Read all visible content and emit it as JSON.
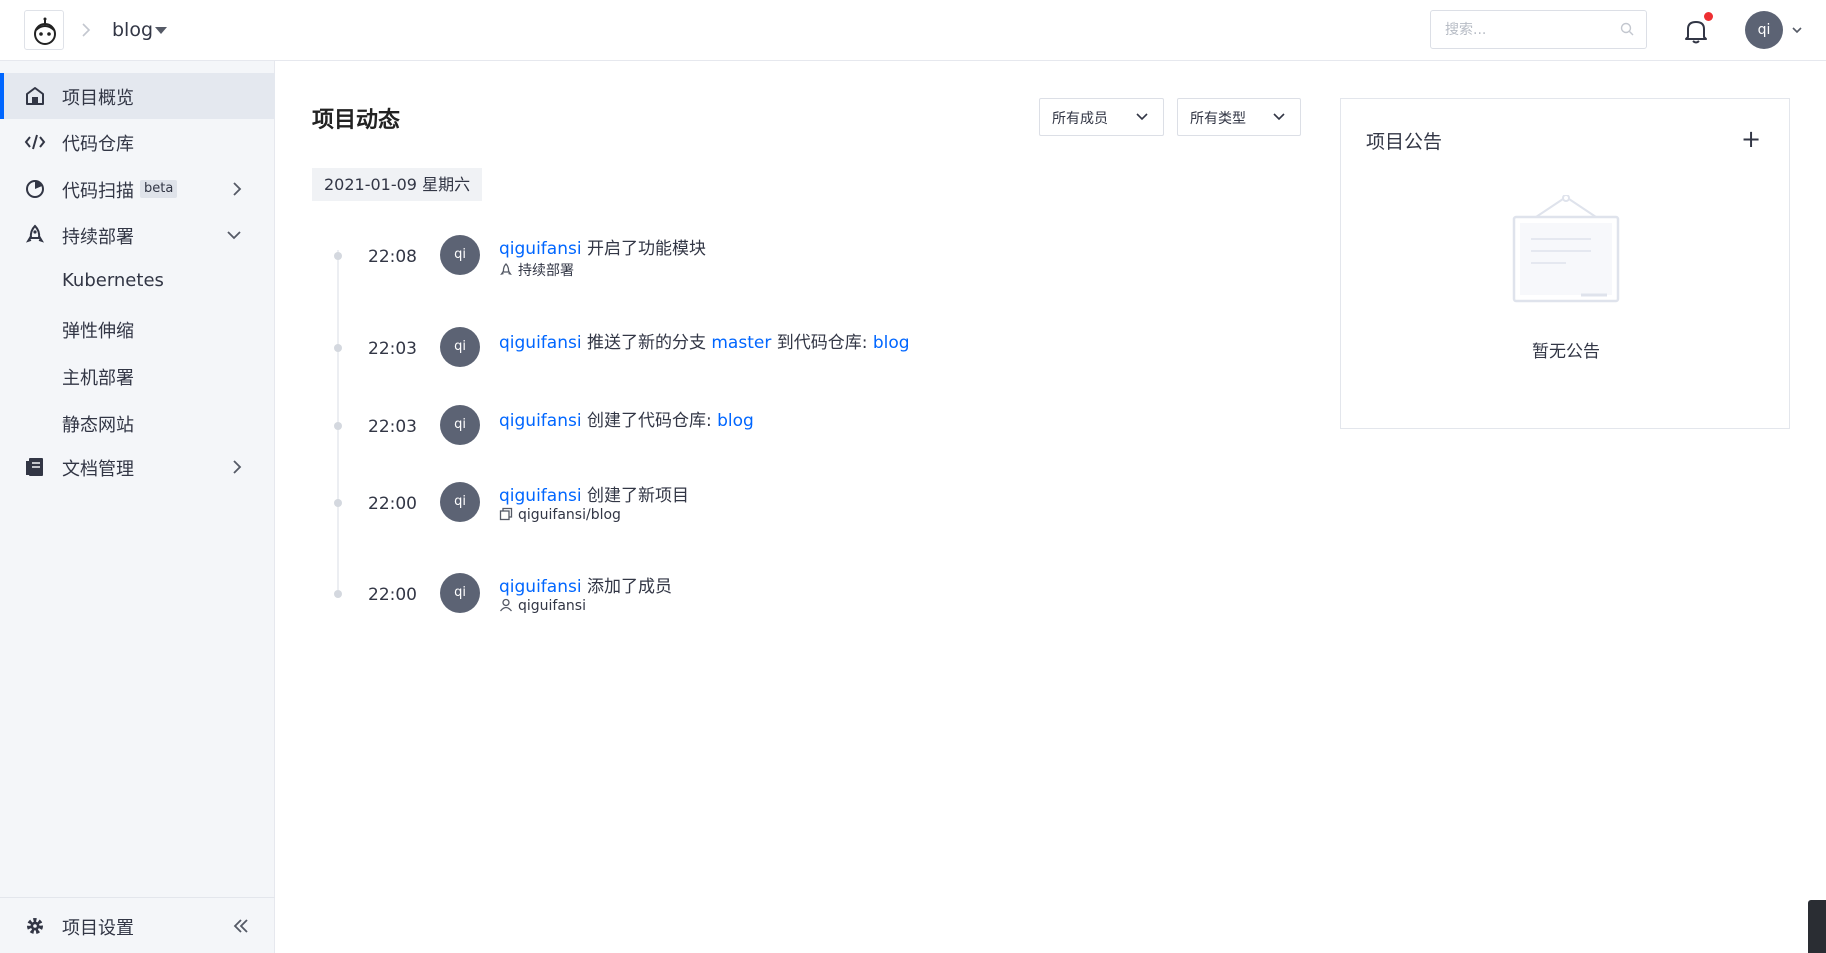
{
  "header": {
    "project_name": "blog",
    "search_placeholder": "搜索...",
    "user_initials": "qi"
  },
  "sidebar": {
    "items": [
      {
        "label": "项目概览",
        "icon": "home-icon",
        "active": true
      },
      {
        "label": "代码仓库",
        "icon": "code-icon"
      },
      {
        "label": "代码扫描",
        "icon": "scan-icon",
        "badge": "beta"
      },
      {
        "label": "持续部署",
        "icon": "rocket-icon"
      },
      {
        "label": "Kubernetes"
      },
      {
        "label": "弹性伸缩"
      },
      {
        "label": "主机部署"
      },
      {
        "label": "静态网站"
      },
      {
        "label": "文档管理",
        "icon": "document-icon"
      }
    ],
    "footer_label": "项目设置"
  },
  "main": {
    "title": "项目动态",
    "filters": {
      "members": "所有成员",
      "types": "所有类型"
    },
    "date": "2021-01-09 星期六",
    "events": [
      {
        "time": "22:08",
        "avatar": "qi",
        "user": "qiguifansi",
        "action": "开启了功能模块",
        "detail": "持续部署",
        "detail_icon": "rocket-icon"
      },
      {
        "time": "22:03",
        "avatar": "qi",
        "user": "qiguifansi",
        "action_1": "推送了新的分支",
        "branch": "master",
        "action_2": "到代码仓库:",
        "repo": "blog"
      },
      {
        "time": "22:03",
        "avatar": "qi",
        "user": "qiguifansi",
        "action": "创建了代码仓库:",
        "repo": "blog"
      },
      {
        "time": "22:00",
        "avatar": "qi",
        "user": "qiguifansi",
        "action": "创建了新项目",
        "detail": "qiguifansi/blog",
        "detail_icon": "project-icon"
      },
      {
        "time": "22:00",
        "avatar": "qi",
        "user": "qiguifansi",
        "action": "添加了成员",
        "detail": "qiguifansi",
        "detail_icon": "user-icon"
      }
    ]
  },
  "notice": {
    "title": "项目公告",
    "add": "+",
    "empty": "暂无公告"
  },
  "colors": {
    "link": "#0066ff",
    "active_bar": "#0066ff",
    "avatar": "#5c6374",
    "sidebar_bg": "#f4f6f9",
    "notify_dot": "#ee2f32"
  }
}
